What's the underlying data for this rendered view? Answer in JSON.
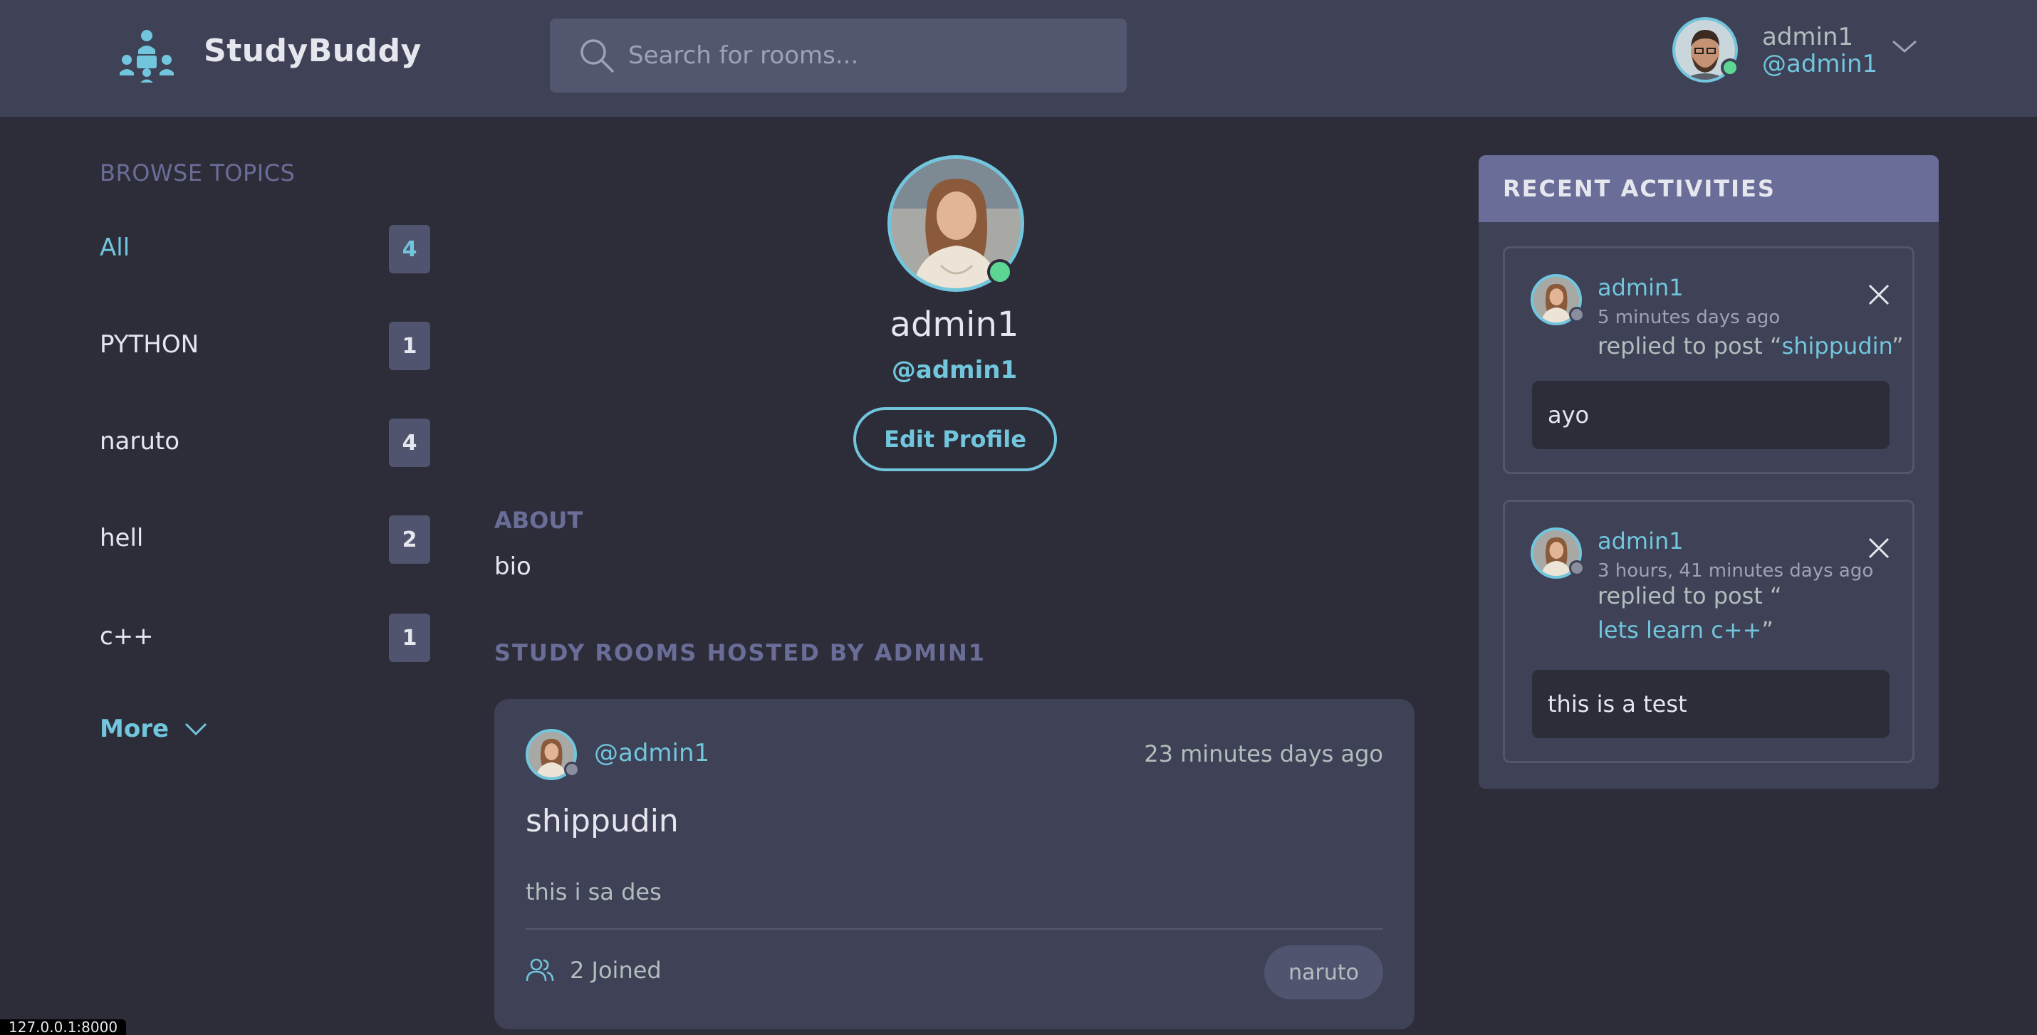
{
  "header": {
    "app_name": "StudyBuddy",
    "search_placeholder": "Search for rooms...",
    "user_name": "admin1",
    "user_handle": "@admin1"
  },
  "sidebar": {
    "title": "BROWSE TOPICS",
    "topics": [
      {
        "label": "All",
        "count": "4",
        "active": true
      },
      {
        "label": "PYTHON",
        "count": "1"
      },
      {
        "label": "naruto",
        "count": "4"
      },
      {
        "label": "hell",
        "count": "2"
      },
      {
        "label": "c++",
        "count": "1"
      }
    ],
    "more_label": "More"
  },
  "profile": {
    "name": "admin1",
    "handle": "@admin1",
    "edit_label": "Edit Profile",
    "about_title": "ABOUT",
    "about_text": "bio",
    "rooms_title": "STUDY ROOMS HOSTED BY ADMIN1"
  },
  "rooms": [
    {
      "host": "@admin1",
      "time": "23 minutes days ago",
      "name": "shippudin",
      "description": "this i sa des",
      "joined": "2 Joined",
      "topic": "naruto"
    }
  ],
  "activities": {
    "title": "RECENT ACTIVITIES",
    "items": [
      {
        "user": "admin1",
        "time": "5 minutes days ago",
        "reply_prefix": "replied to post “",
        "post": "shippudin",
        "reply_suffix": "”",
        "message": "ayo"
      },
      {
        "user": "admin1",
        "time": "3 hours, 41 minutes days ago",
        "reply_prefix": "replied to post “",
        "post": "lets learn c++",
        "reply_suffix": "”",
        "message": "this is a test"
      }
    ]
  },
  "status_bar": {
    "text": "127.0.0.1:8000"
  },
  "colors": {
    "background": "#2d2d39",
    "panel": "#3f4156",
    "accent": "#71c6dd",
    "muted_title": "#696d97",
    "online": "#5dd693"
  }
}
